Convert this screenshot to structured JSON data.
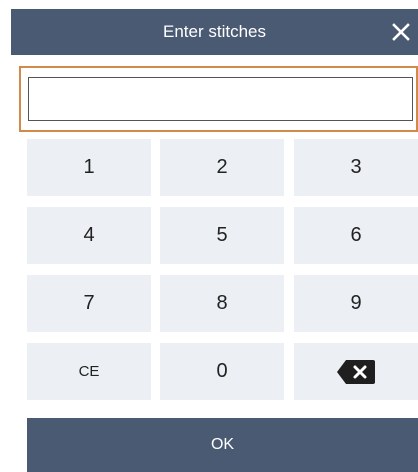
{
  "dialog": {
    "title": "Enter stitches",
    "close_icon": "close-icon",
    "input_value": "",
    "input_placeholder": ""
  },
  "keypad": {
    "k1": "1",
    "k2": "2",
    "k3": "3",
    "k4": "4",
    "k5": "5",
    "k6": "6",
    "k7": "7",
    "k8": "8",
    "k9": "9",
    "ce": "CE",
    "k0": "0",
    "backspace_icon": "backspace-icon"
  },
  "actions": {
    "ok_label": "OK"
  },
  "colors": {
    "header_bg": "#4a5a73",
    "input_focus_border": "#d18a4a",
    "key_bg": "#ecf0f4",
    "key_text": "#222222",
    "backspace_icon": "#1f1f1f"
  }
}
